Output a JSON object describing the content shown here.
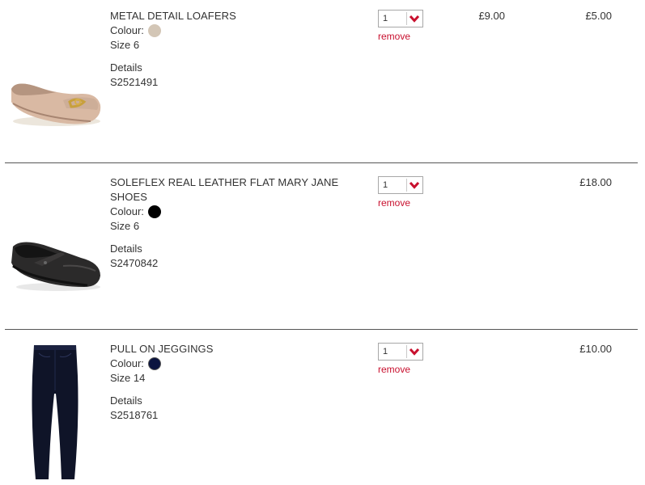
{
  "items": [
    {
      "name": "METAL DETAIL LOAFERS",
      "colour_label": "Colour:",
      "swatch_color": "#d3c6b6",
      "size": "Size 6",
      "details_label": "Details",
      "code": "S2521491",
      "quantity": "1",
      "remove_label": "remove",
      "price_was": "£9.00",
      "price_now": "£5.00",
      "image_icon": "beige-loafer-shoe"
    },
    {
      "name": "SOLEFLEX REAL LEATHER FLAT MARY JANE SHOES",
      "colour_label": "Colour:",
      "swatch_color": "#000000",
      "size": "Size 6",
      "details_label": "Details",
      "code": "S2470842",
      "quantity": "1",
      "remove_label": "remove",
      "price_was": "",
      "price_now": "£18.00",
      "image_icon": "black-mary-jane-shoe"
    },
    {
      "name": "PULL ON JEGGINGS",
      "colour_label": "Colour:",
      "swatch_color": "#0b1440",
      "size": "Size 14",
      "details_label": "Details",
      "code": "S2518761",
      "quantity": "1",
      "remove_label": "remove",
      "price_was": "",
      "price_now": "£10.00",
      "image_icon": "navy-jeggings"
    }
  ],
  "accent_color": "#c8102e"
}
